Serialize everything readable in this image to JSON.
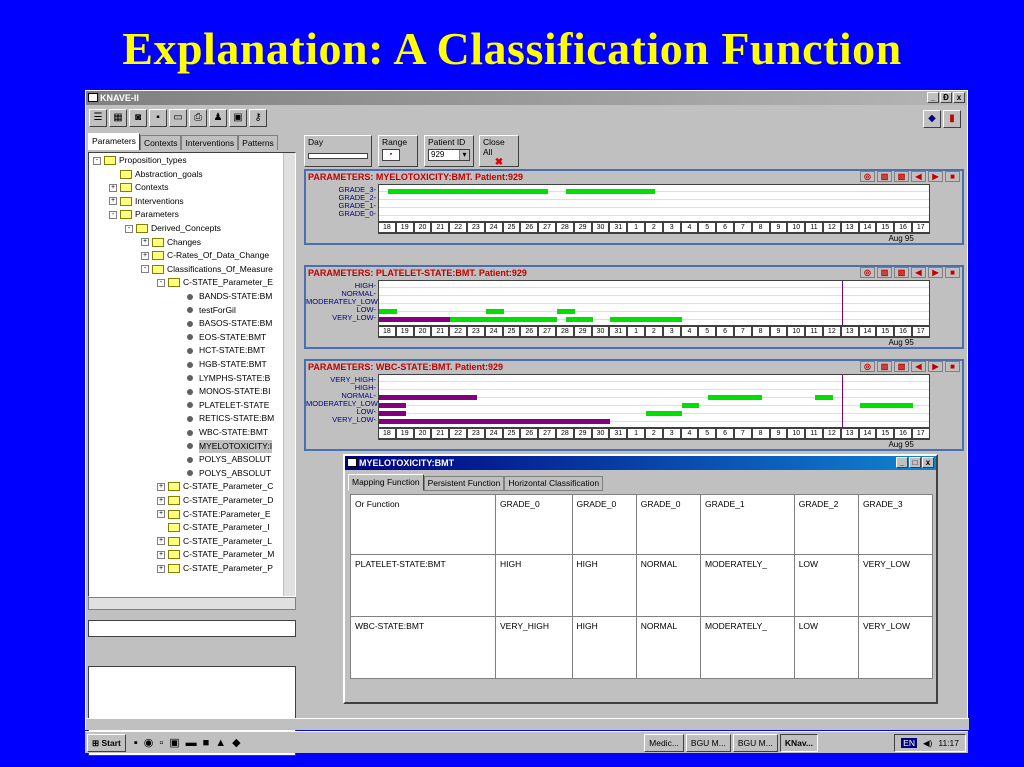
{
  "slide": {
    "title": "Explanation: A Classification Function"
  },
  "window": {
    "title": "KNAVE-II",
    "minimize": "_",
    "restore": "Ɖ",
    "close": "x"
  },
  "toolbar_icons": [
    "tree-view-icon",
    "table-icon",
    "camera-icon",
    "save-icon",
    "open-folder-icon",
    "print-icon",
    "figure-icon",
    "monitor-icon",
    "key-icon"
  ],
  "left_tabs": [
    "Parameters",
    "Contexts",
    "Interventions",
    "Patterns"
  ],
  "tree": [
    {
      "label": "Proposition_types",
      "depth": 0,
      "type": "folder",
      "pm": "-"
    },
    {
      "label": "Abstraction_goals",
      "depth": 1,
      "type": "folder",
      "pm": ""
    },
    {
      "label": "Contexts",
      "depth": 1,
      "type": "folder",
      "pm": "+"
    },
    {
      "label": "Interventions",
      "depth": 1,
      "type": "folder",
      "pm": "+"
    },
    {
      "label": "Parameters",
      "depth": 1,
      "type": "folder",
      "pm": "-"
    },
    {
      "label": "Derived_Concepts",
      "depth": 2,
      "type": "folder",
      "pm": "-"
    },
    {
      "label": "Changes",
      "depth": 3,
      "type": "folder",
      "pm": "+"
    },
    {
      "label": "C-Rates_Of_Data_Change",
      "depth": 3,
      "type": "folder",
      "pm": "+"
    },
    {
      "label": "Classifications_Of_Measure",
      "depth": 3,
      "type": "folder",
      "pm": "-"
    },
    {
      "label": "C-STATE_Parameter_E",
      "depth": 4,
      "type": "folder",
      "pm": "-"
    },
    {
      "label": "BANDS-STATE:BM",
      "depth": 5,
      "type": "leaf",
      "pm": ""
    },
    {
      "label": "testForGil",
      "depth": 5,
      "type": "leaf",
      "pm": ""
    },
    {
      "label": "BASOS-STATE:BM",
      "depth": 5,
      "type": "leaf",
      "pm": ""
    },
    {
      "label": "EOS-STATE:BMT",
      "depth": 5,
      "type": "leaf",
      "pm": ""
    },
    {
      "label": "HCT-STATE:BMT",
      "depth": 5,
      "type": "leaf",
      "pm": ""
    },
    {
      "label": "HGB-STATE:BMT",
      "depth": 5,
      "type": "leaf",
      "pm": ""
    },
    {
      "label": "LYMPHS-STATE:B",
      "depth": 5,
      "type": "leaf",
      "pm": ""
    },
    {
      "label": "MONOS-STATE:BI",
      "depth": 5,
      "type": "leaf",
      "pm": ""
    },
    {
      "label": "PLATELET-STATE",
      "depth": 5,
      "type": "leaf",
      "pm": ""
    },
    {
      "label": "RETICS-STATE:BM",
      "depth": 5,
      "type": "leaf",
      "pm": ""
    },
    {
      "label": "WBC-STATE:BMT",
      "depth": 5,
      "type": "leaf",
      "pm": ""
    },
    {
      "label": "MYELOTOXICITY:I",
      "depth": 5,
      "type": "leaf",
      "pm": "",
      "selected": true
    },
    {
      "label": "POLYS_ABSOLUT",
      "depth": 5,
      "type": "leaf",
      "pm": ""
    },
    {
      "label": "POLYS_ABSOLUT",
      "depth": 5,
      "type": "leaf",
      "pm": ""
    },
    {
      "label": "C-STATE_Parameter_C",
      "depth": 4,
      "type": "folder",
      "pm": "+"
    },
    {
      "label": "C-STATE_Parameter_D",
      "depth": 4,
      "type": "folder",
      "pm": "+"
    },
    {
      "label": "C-STATE:Parameter_E",
      "depth": 4,
      "type": "folder",
      "pm": "+"
    },
    {
      "label": "C-STATE_Parameter_I",
      "depth": 4,
      "type": "folder",
      "pm": ""
    },
    {
      "label": "C-STATE_Parameter_L",
      "depth": 4,
      "type": "folder",
      "pm": "+"
    },
    {
      "label": "C-STATE_Parameter_M",
      "depth": 4,
      "type": "folder",
      "pm": "+"
    },
    {
      "label": "C-STATE_Parameter_P",
      "depth": 4,
      "type": "folder",
      "pm": "+"
    }
  ],
  "controls": {
    "day_label": "Day",
    "range_label": "Range",
    "patient_label": "Patient ID",
    "patient_value": "929",
    "close_all": "Close All"
  },
  "axis": {
    "days": [
      "18",
      "19",
      "20",
      "21",
      "22",
      "23",
      "24",
      "25",
      "26",
      "27",
      "28",
      "29",
      "30",
      "31",
      "1",
      "2",
      "3",
      "4",
      "5",
      "6",
      "7",
      "8",
      "9",
      "10",
      "11",
      "12",
      "13",
      "14",
      "15",
      "16",
      "17"
    ],
    "month": "Aug 95"
  },
  "panels": [
    {
      "title": "PARAMETERS: MYELOTOXICITY:BMT. Patient:929",
      "levels": [
        "GRADE_3",
        "GRADE_2",
        "GRADE_1",
        "GRADE_0"
      ],
      "bars": [
        {
          "level": 0,
          "from": 18.5,
          "to": 27.5,
          "color": "#00e000"
        },
        {
          "level": 0,
          "from": 28.5,
          "to": 33.5,
          "color": "#00e000"
        }
      ]
    },
    {
      "title": "PARAMETERS: PLATELET-STATE:BMT. Patient:929",
      "levels": [
        "HIGH",
        "NORMAL",
        "MODERATELY_LOW",
        "LOW",
        "VERY_LOW"
      ],
      "bars": [
        {
          "level": 3,
          "from": 18,
          "to": 19,
          "color": "#00e000"
        },
        {
          "level": 3,
          "from": 24,
          "to": 25,
          "color": "#00e000"
        },
        {
          "level": 4,
          "from": 18,
          "to": 22,
          "color": "#800080"
        },
        {
          "level": 4,
          "from": 22,
          "to": 28,
          "color": "#00e000"
        },
        {
          "level": 3,
          "from": 28,
          "to": 29,
          "color": "#00e000"
        },
        {
          "level": 4,
          "from": 28.5,
          "to": 30,
          "color": "#00e000"
        },
        {
          "level": 4,
          "from": 31,
          "to": 35,
          "color": "#00e000"
        }
      ]
    },
    {
      "title": "PARAMETERS: WBC-STATE:BMT. Patient:929",
      "levels": [
        "VERY_HIGH",
        "HIGH",
        "NORMAL",
        "MODERATELY_LOW",
        "LOW",
        "VERY_LOW"
      ],
      "bars": [
        {
          "level": 2,
          "from": 18,
          "to": 23.5,
          "color": "#800080"
        },
        {
          "level": 3,
          "from": 18,
          "to": 19.5,
          "color": "#800080"
        },
        {
          "level": 4,
          "from": 18,
          "to": 19.5,
          "color": "#800080"
        },
        {
          "level": 5,
          "from": 18,
          "to": 31,
          "color": "#800080"
        },
        {
          "level": 4,
          "from": 33,
          "to": 35,
          "color": "#00e000"
        },
        {
          "level": 3,
          "from": 35,
          "to": 36,
          "color": "#00e000"
        },
        {
          "level": 2,
          "from": 36.5,
          "to": 39.5,
          "color": "#00e000"
        },
        {
          "level": 2,
          "from": 42.5,
          "to": 43.5,
          "color": "#00e000"
        },
        {
          "level": 3,
          "from": 45,
          "to": 48,
          "color": "#00e000"
        }
      ]
    }
  ],
  "dialog": {
    "title": "MYELOTOXICITY:BMT",
    "tabs": [
      "Mapping Function",
      "Persistent Function",
      "Horizontal Classification"
    ],
    "table": [
      [
        "Or Function",
        "GRADE_0",
        "GRADE_0",
        "GRADE_0",
        "GRADE_1",
        "GRADE_2",
        "GRADE_3"
      ],
      [
        "PLATELET-STATE:BMT",
        "HIGH",
        "HIGH",
        "NORMAL",
        "MODERATELY_",
        "LOW",
        "VERY_LOW"
      ],
      [
        "WBC-STATE:BMT",
        "VERY_HIGH",
        "HIGH",
        "NORMAL",
        "MODERATELY_",
        "LOW",
        "VERY_LOW"
      ]
    ]
  },
  "taskbar": {
    "start": "Start",
    "items": [
      "Medic...",
      "BGU M...",
      "BGU M...",
      "KNav..."
    ],
    "clock": "11:17",
    "lang": "EN"
  }
}
